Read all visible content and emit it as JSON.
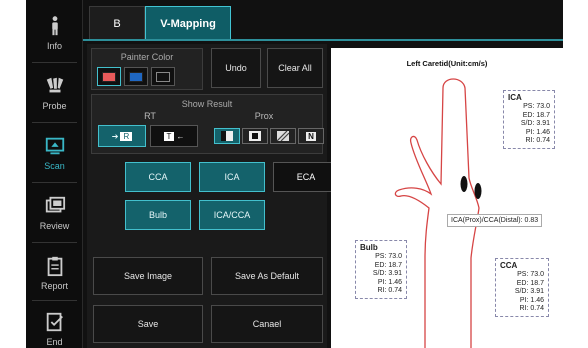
{
  "nav": {
    "items": [
      {
        "label": "Info",
        "icon": "person-icon"
      },
      {
        "label": "Probe",
        "icon": "probe-icon"
      },
      {
        "label": "Scan",
        "icon": "scan-icon"
      },
      {
        "label": "Review",
        "icon": "review-icon"
      },
      {
        "label": "Report",
        "icon": "report-icon"
      },
      {
        "label": "End",
        "icon": "end-icon"
      }
    ],
    "active": "Scan"
  },
  "tabs": {
    "b": "B",
    "vmapping": "V-Mapping",
    "active": "V-Mapping"
  },
  "painter": {
    "title": "Painter Color",
    "colors": [
      "#e85a5a",
      "#1f67c2",
      "#111111"
    ],
    "undo": "Undo",
    "clear_all": "Clear All"
  },
  "show_result": {
    "title": "Show Result",
    "rt_label": "RT",
    "prox_label": "Prox",
    "rt_buttons": [
      "R",
      "T"
    ],
    "prox_buttons": [
      "N"
    ]
  },
  "vessels": {
    "cca": "CCA",
    "ica": "ICA",
    "eca": "ECA",
    "bulb": "Bulb",
    "ica_cca": "ICA/CCA"
  },
  "actions": {
    "save_image": "Save Image",
    "save_default": "Save As Default",
    "save": "Save",
    "cancel": "Canael"
  },
  "image": {
    "title": "Left Caretid(Unit:cm/s)",
    "ratio": "ICA(Prox)/CCA(Distal): 0.83",
    "ica": {
      "title": "ICA",
      "ps": "PS: 73.0",
      "ed": "ED: 18.7",
      "sd": "S/D: 3.91",
      "pi": "PI: 1.46",
      "ri": "RI: 0.74"
    },
    "bulb": {
      "title": "Bulb",
      "ps": "PS: 73.0",
      "ed": "ED: 18.7",
      "sd": "S/D: 3.91",
      "pi": "PI: 1.46",
      "ri": "RI: 0.74"
    },
    "cca": {
      "title": "CCA",
      "ps": "PS: 73.0",
      "ed": "ED: 18.7",
      "sd": "S/D: 3.91",
      "pi": "PI: 1.46",
      "ri": "RI: 0.74"
    }
  },
  "colors": {
    "accent": "#39b7c6",
    "vessel_outline": "#d64545"
  }
}
